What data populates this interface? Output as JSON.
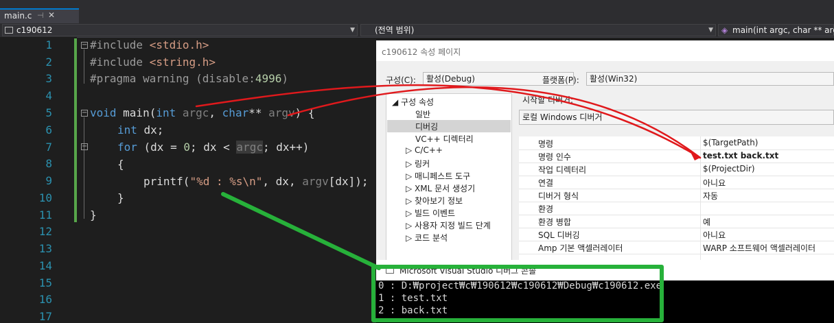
{
  "tab": {
    "label": "main.c",
    "pin": "⊣",
    "close": "✕"
  },
  "navbar": {
    "project": "c190612",
    "scope": "(전역 범위)",
    "member": "main(int argc, char ** argv)"
  },
  "line_numbers": [
    "1",
    "2",
    "3",
    "4",
    "5",
    "6",
    "7",
    "8",
    "9",
    "10",
    "11",
    "12",
    "13",
    "14",
    "15",
    "16",
    "17"
  ],
  "code": {
    "l1_hash": "#include ",
    "l1_hdr": "<stdio.h>",
    "l2_hash": "#include ",
    "l2_hdr": "<string.h>",
    "l3_a": "#pragma warning (disable:",
    "l3_num": "4996",
    "l3_b": ")",
    "l5_kw1": "void",
    "l5_a": " main(",
    "l5_kw2": "int",
    "l5_p1": " argc",
    "l5_b": ", ",
    "l5_kw3": "char",
    "l5_c": "** ",
    "l5_p2": "argv",
    "l5_d": ") {",
    "l6_kw": "int",
    "l6_a": " dx;",
    "l7_kw": "for",
    "l7_a": " (dx = ",
    "l7_num": "0",
    "l7_b": "; dx < ",
    "l7_p": "argc",
    "l7_c": "; dx++)",
    "l8": "{",
    "l9_a": "printf(",
    "l9_str": "\"%d : %s\\n\"",
    "l9_b": ", dx, ",
    "l9_p": "argv",
    "l9_c": "[dx]);",
    "l10": "}",
    "l11": "}"
  },
  "dialog": {
    "title": "c190612 속성 페이지",
    "config_label": "구성(C):",
    "config_value": "활성(Debug)",
    "platform_label": "플랫폼(P):",
    "platform_value": "활성(Win32)",
    "debugger_label": "시작할 디버거:",
    "debugger_value": "로컬 Windows 디버거",
    "tree": [
      "◢ 구성 속성",
      "일반",
      "디버깅",
      "VC++ 디렉터리",
      "▷ C/C++",
      "▷ 링커",
      "▷ 매니페스트 도구",
      "▷ XML 문서 생성기",
      "▷ 찾아보기 정보",
      "▷ 빌드 이벤트",
      "▷ 사용자 지정 빌드 단계",
      "▷ 코드 분석"
    ],
    "props": [
      {
        "name": "명령",
        "value": "$(TargetPath)"
      },
      {
        "name": "명령 인수",
        "value": "test.txt back.txt"
      },
      {
        "name": "작업 디렉터리",
        "value": "$(ProjectDir)"
      },
      {
        "name": "연결",
        "value": "아니요"
      },
      {
        "name": "디버거 형식",
        "value": "자동"
      },
      {
        "name": "환경",
        "value": ""
      },
      {
        "name": "환경 병합",
        "value": "예"
      },
      {
        "name": "SQL 디버깅",
        "value": "아니요"
      },
      {
        "name": "Amp 기본 액셀러레이터",
        "value": "WARP 소프트웨어 액셀러레이터"
      }
    ]
  },
  "console": {
    "title": "Microsoft Visual Studio 디버그 콘솔",
    "lines": [
      "0 : D:₩project₩c₩190612₩c190612₩Debug₩c190612.exe",
      "1 : test.txt",
      "2 : back.txt"
    ]
  },
  "colors": {
    "annotation_red": "#e0191c",
    "annotation_green": "#27b13a"
  }
}
